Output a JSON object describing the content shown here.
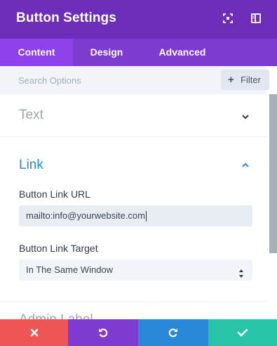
{
  "header": {
    "title": "Button Settings",
    "icons": [
      "expand-icon",
      "sidebar-toggle-icon"
    ]
  },
  "tabs": [
    {
      "label": "Content",
      "active": true
    },
    {
      "label": "Design",
      "active": false
    },
    {
      "label": "Advanced",
      "active": false
    }
  ],
  "search": {
    "placeholder": "Search Options",
    "filter_label": "Filter"
  },
  "sections": {
    "text": {
      "title": "Text",
      "expanded": false
    },
    "link": {
      "title": "Link",
      "expanded": true
    }
  },
  "link_fields": {
    "url_label": "Button Link URL",
    "url_value": "mailto:info@yourwebsite.com",
    "target_label": "Button Link Target",
    "target_value": "In The Same Window"
  },
  "next_section_peek": "Admin Label",
  "footer": {
    "buttons": [
      {
        "name": "discard",
        "icon": "close-icon",
        "color": "#ef5555"
      },
      {
        "name": "undo",
        "icon": "undo-icon",
        "color": "#7e3bd0"
      },
      {
        "name": "redo",
        "icon": "redo-icon",
        "color": "#2b87da"
      },
      {
        "name": "save",
        "icon": "check-icon",
        "color": "#29c4a9"
      }
    ]
  },
  "colors": {
    "header": "#6c2eb9",
    "tabs": "#7e3bd0",
    "active_tab": "#8f42ec",
    "link_accent": "#2b87da"
  }
}
